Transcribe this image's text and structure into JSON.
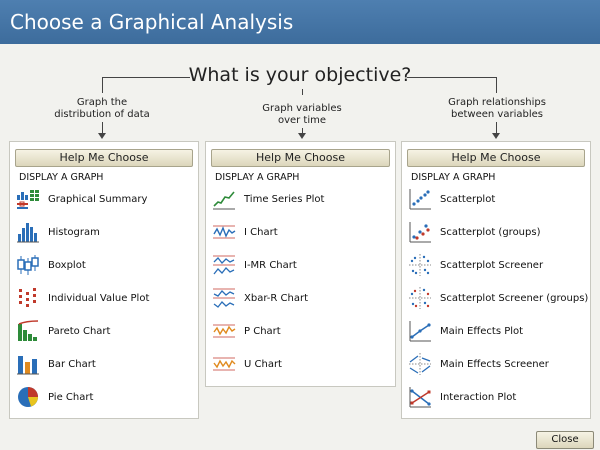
{
  "window": {
    "title": "Choose a Graphical Analysis"
  },
  "objective": "What is your objective?",
  "columns": [
    {
      "label_line1": "Graph the",
      "label_line2": "distribution of data",
      "help_label": "Help Me Choose",
      "heading": "DISPLAY A GRAPH",
      "items": [
        {
          "label": "Graphical Summary",
          "icon": "graphical-summary-icon"
        },
        {
          "label": "Histogram",
          "icon": "histogram-icon"
        },
        {
          "label": "Boxplot",
          "icon": "boxplot-icon"
        },
        {
          "label": "Individual Value Plot",
          "icon": "individual-value-plot-icon"
        },
        {
          "label": "Pareto Chart",
          "icon": "pareto-chart-icon"
        },
        {
          "label": "Bar Chart",
          "icon": "bar-chart-icon"
        },
        {
          "label": "Pie Chart",
          "icon": "pie-chart-icon"
        }
      ]
    },
    {
      "label_line1": "Graph variables",
      "label_line2": "over time",
      "help_label": "Help Me Choose",
      "heading": "DISPLAY A GRAPH",
      "items": [
        {
          "label": "Time Series Plot",
          "icon": "time-series-icon"
        },
        {
          "label": "I Chart",
          "icon": "i-chart-icon"
        },
        {
          "label": "I-MR Chart",
          "icon": "i-mr-chart-icon"
        },
        {
          "label": "Xbar-R Chart",
          "icon": "xbar-r-chart-icon"
        },
        {
          "label": "P Chart",
          "icon": "p-chart-icon"
        },
        {
          "label": "U Chart",
          "icon": "u-chart-icon"
        }
      ]
    },
    {
      "label_line1": "Graph relationships",
      "label_line2": "between variables",
      "help_label": "Help Me Choose",
      "heading": "DISPLAY A GRAPH",
      "items": [
        {
          "label": "Scatterplot",
          "icon": "scatterplot-icon"
        },
        {
          "label": "Scatterplot (groups)",
          "icon": "scatterplot-groups-icon"
        },
        {
          "label": "Scatterplot Screener",
          "icon": "scatterplot-screener-icon"
        },
        {
          "label": "Scatterplot Screener (groups)",
          "icon": "scatterplot-screener-groups-icon"
        },
        {
          "label": "Main Effects Plot",
          "icon": "main-effects-plot-icon"
        },
        {
          "label": "Main Effects Screener",
          "icon": "main-effects-screener-icon"
        },
        {
          "label": "Interaction Plot",
          "icon": "interaction-plot-icon"
        }
      ]
    }
  ],
  "close_label": "Close",
  "colors": {
    "titlebar": "#4a7bab",
    "blue": "#2a6eb8",
    "green": "#2e8b3a",
    "orange": "#e08a1e",
    "red": "#c0392b"
  }
}
